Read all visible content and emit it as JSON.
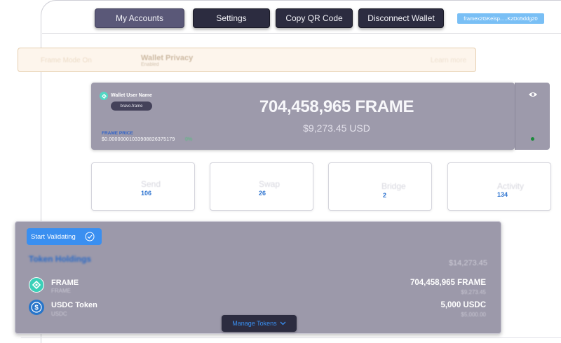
{
  "nav": {
    "my_accounts": "My Accounts",
    "settings": "Settings",
    "copy_qr": "Copy QR Code",
    "disconnect": "Disconnect Wallet",
    "address": "framex2GKeisp.....KzDo5ddg20"
  },
  "banner": {
    "left_text": "Frame Mode On",
    "title": "Wallet Privacy",
    "subtitle": "Enabled",
    "right_text": "Learn more"
  },
  "wallet": {
    "name": "Wallet User Name",
    "handle": "bravo.frame",
    "balance": "704,458,965 FRAME",
    "balance_usd": "$9,273.45 USD",
    "price_label": "FRAME PRICE",
    "price_value": "$0.00000001033908826375179",
    "price_change": "0%"
  },
  "actions": [
    {
      "label": "Send",
      "count": "106"
    },
    {
      "label": "Swap",
      "count": "26"
    },
    {
      "label": "Bridge",
      "count": "2"
    },
    {
      "label": "Activity",
      "count": "134"
    }
  ],
  "holdings": {
    "start_validating": "Start Validating",
    "title": "Token Holdings",
    "total": "$14,273.45",
    "tokens": [
      {
        "name": "FRAME",
        "symbol": "FRAME",
        "amount": "704,458,965 FRAME",
        "usd": "$9,273.45",
        "icon": "frame-token-icon"
      },
      {
        "name": "USDC Token",
        "symbol": "USDC",
        "amount": "5,000 USDC",
        "usd": "$5,000.00",
        "icon": "usdc-token-icon"
      }
    ],
    "manage": "Manage Tokens"
  },
  "colors": {
    "nav_bg": "#2c2c40",
    "nav_active": "#5a5878",
    "accent": "#3a8ff0",
    "card_bg": "#9d9aab",
    "status_green": "#1a8a3a"
  }
}
